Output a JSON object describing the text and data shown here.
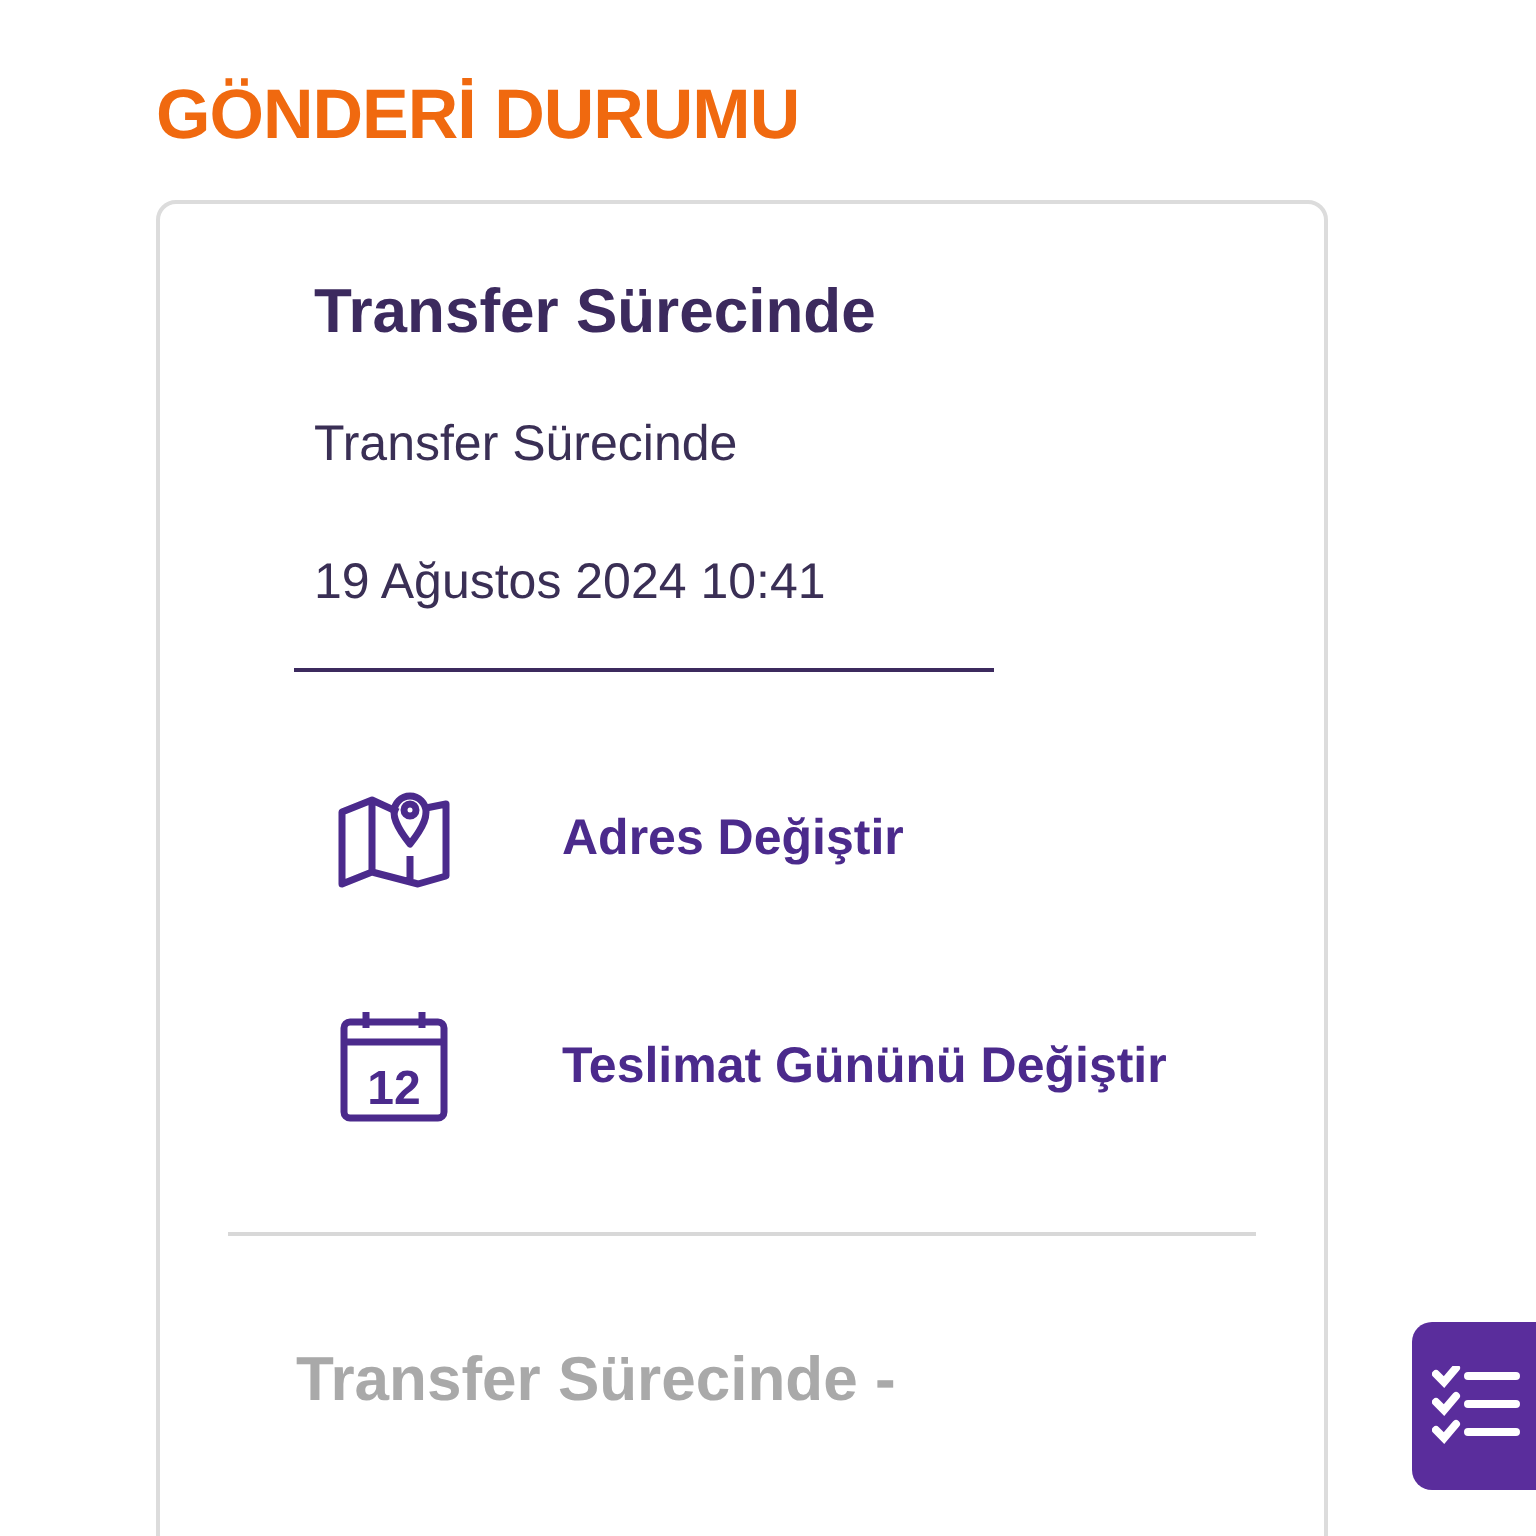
{
  "title": "GÖNDERİ DURUMU",
  "status": {
    "heading": "Transfer Sürecinde",
    "description": "Transfer Sürecinde",
    "date": "19 Ağustos 2024 10:41"
  },
  "actions": [
    {
      "kind": "map",
      "label": "Adres Değiştir"
    },
    {
      "kind": "calendar",
      "label": "Teslimat Gününü Değiştir",
      "day": "12"
    }
  ],
  "next_status": {
    "heading": "Transfer Sürecinde -"
  }
}
